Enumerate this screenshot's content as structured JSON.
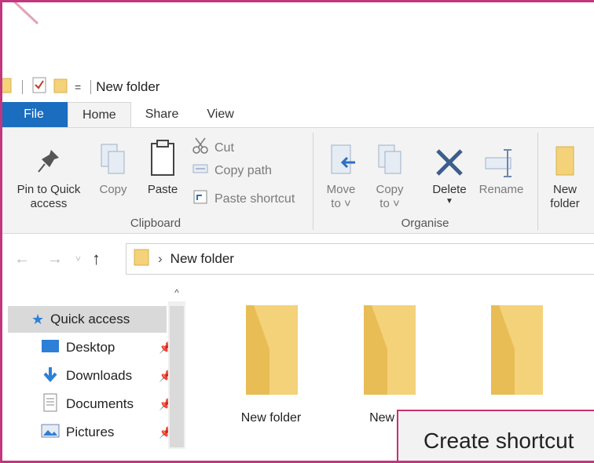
{
  "window": {
    "title": "New folder",
    "quick_access_dropdown": "="
  },
  "ribbon_tabs": [
    {
      "label": "File"
    },
    {
      "label": "Home"
    },
    {
      "label": "Share"
    },
    {
      "label": "View"
    }
  ],
  "clipboard": {
    "group_label": "Clipboard",
    "pin_label_1": "Pin to Quick",
    "pin_label_2": "access",
    "copy_label": "Copy",
    "paste_label": "Paste",
    "cut_label": "Cut",
    "copy_path_label": "Copy path",
    "paste_shortcut_label": "Paste shortcut"
  },
  "organise": {
    "group_label": "Organise",
    "move_label_1": "Move",
    "move_label_2": "to ˅",
    "copy_label_1": "Copy",
    "copy_label_2": "to ˅",
    "delete_label": "Delete",
    "rename_label": "Rename"
  },
  "new_group": {
    "new_folder_label_1": "New",
    "new_folder_label_2": "folder"
  },
  "address": {
    "path": "New folder",
    "separator": "›"
  },
  "nav": {
    "items": [
      {
        "label": "Quick access",
        "icon": "star-icon",
        "pinned": false
      },
      {
        "label": "Desktop",
        "icon": "desktop-icon",
        "pinned": true
      },
      {
        "label": "Downloads",
        "icon": "download-icon",
        "pinned": true
      },
      {
        "label": "Documents",
        "icon": "documents-icon",
        "pinned": true
      },
      {
        "label": "Pictures",
        "icon": "pictures-icon",
        "pinned": true
      }
    ]
  },
  "files": [
    {
      "label": "New folder"
    },
    {
      "label": "New fo"
    },
    {
      "label": ""
    }
  ],
  "context_menu": {
    "item": "Create shortcut"
  },
  "colors": {
    "accent": "#1b6dbf",
    "frame": "#c2367f",
    "folder": "#f4d27a",
    "folder_dark": "#e8bd55"
  }
}
